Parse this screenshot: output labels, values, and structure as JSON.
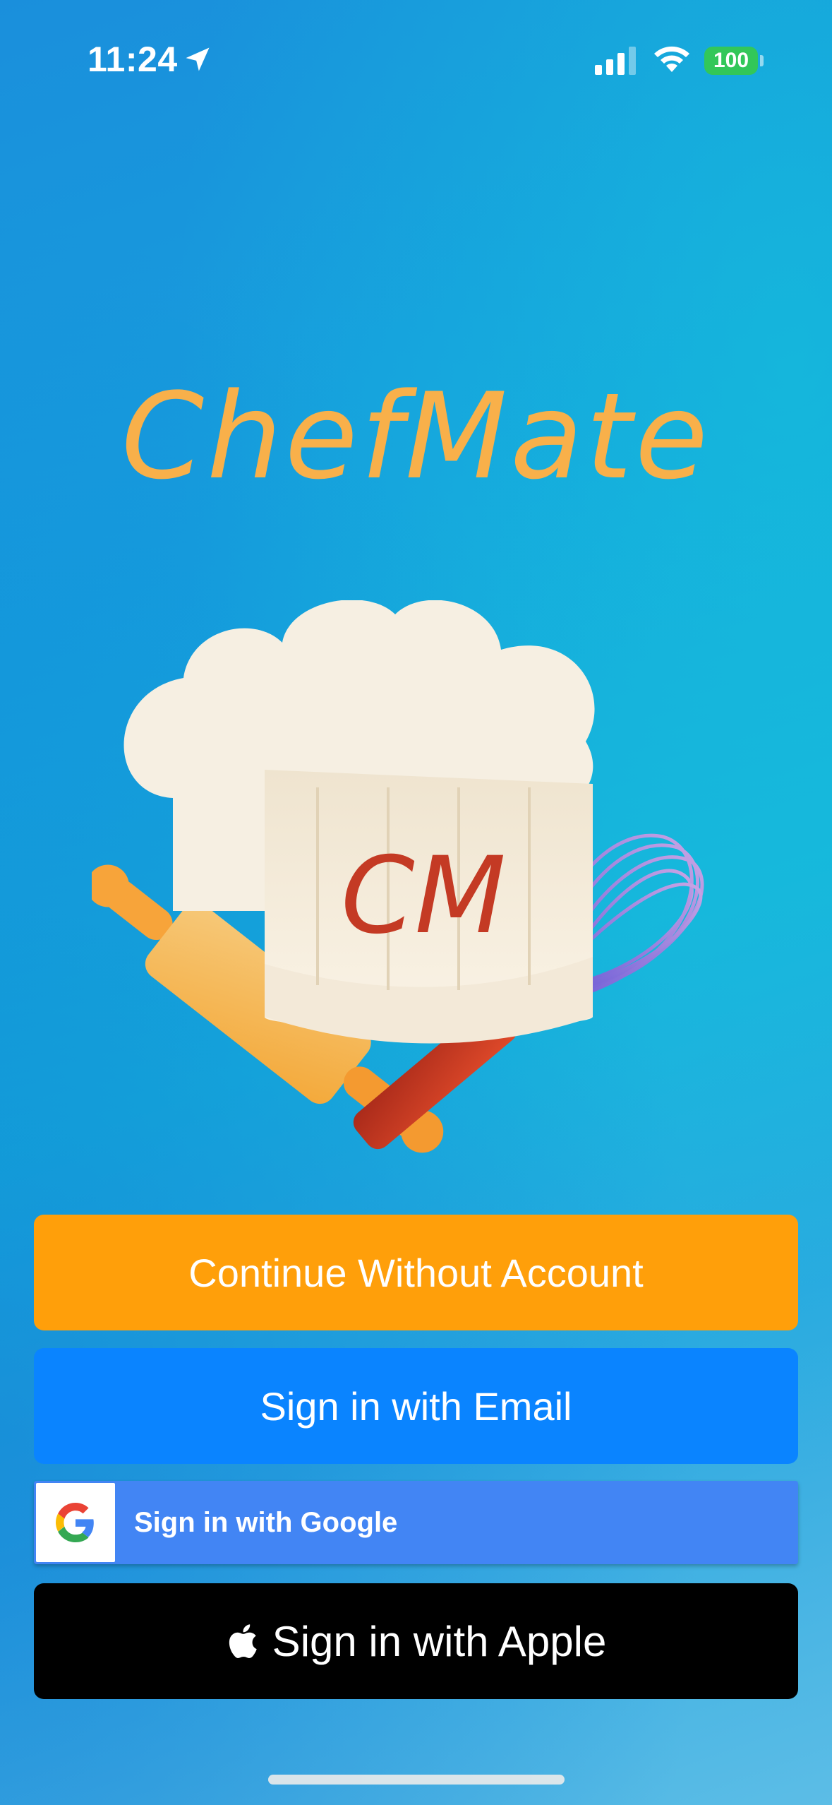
{
  "status_bar": {
    "time": "11:24",
    "battery": "100",
    "location_icon": "location-arrow-icon",
    "signal_icon": "cellular-signal-icon",
    "wifi_icon": "wifi-icon"
  },
  "app": {
    "title": "ChefMate",
    "logo_text": "CM",
    "logo_icons": [
      "chef-hat-icon",
      "rolling-pin-icon",
      "whisk-icon"
    ]
  },
  "buttons": {
    "guest": "Continue Without Account",
    "email": "Sign in with Email",
    "google": "Sign in with Google",
    "apple": "Sign in with Apple"
  },
  "colors": {
    "title": "#f8b04a",
    "guest_button": "#ff9f0a",
    "email_button": "#0a84ff",
    "google_button": "#4285f4",
    "apple_button": "#000000",
    "battery": "#32c759"
  }
}
